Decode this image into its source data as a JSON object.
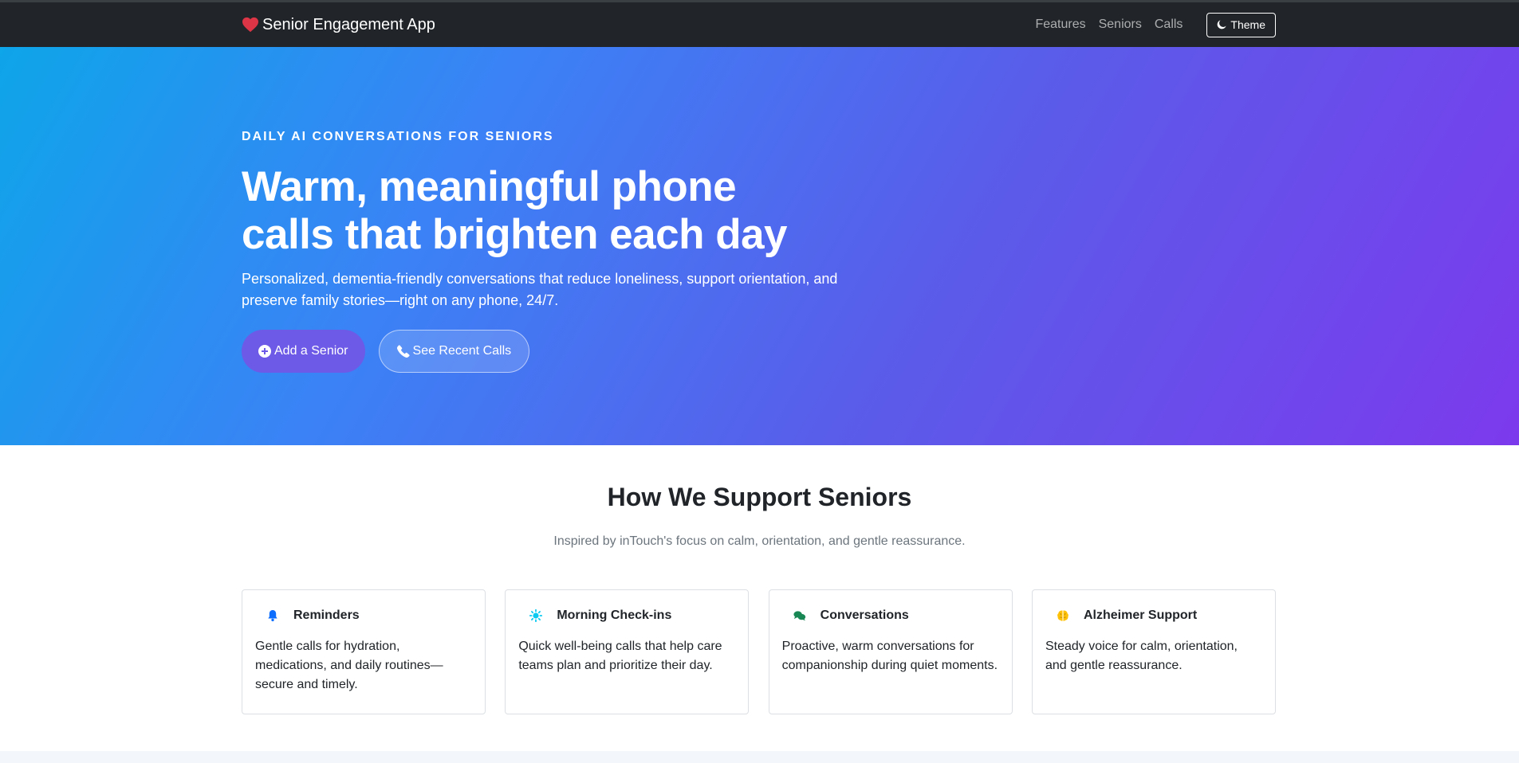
{
  "nav": {
    "brand": "Senior Engagement App",
    "links": [
      "Features",
      "Seniors",
      "Calls"
    ],
    "theme_label": "Theme"
  },
  "hero": {
    "eyebrow": "DAILY AI CONVERSATIONS FOR SENIORS",
    "headline_line1": "Warm, meaningful phone",
    "headline_line2": "calls that brighten each day",
    "subtext": "Personalized, dementia-friendly conversations that reduce loneliness, support orientation, and preserve family stories—right on any phone, 24/7.",
    "primary_button": "Add a Senior",
    "secondary_button": "See Recent Calls"
  },
  "features": {
    "title": "How We Support Seniors",
    "subtitle": "Inspired by inTouch's focus on calm, orientation, and gentle reassurance.",
    "cards": [
      {
        "title": "Reminders",
        "text": "Gentle calls for hydration, medications, and daily routines—secure and timely.",
        "icon": "bell-icon",
        "color": "#0d6efd"
      },
      {
        "title": "Morning Check-ins",
        "text": "Quick well-being calls that help care teams plan and prioritize their day.",
        "icon": "sun-icon",
        "color": "#0dcaf0"
      },
      {
        "title": "Conversations",
        "text": "Proactive, warm conversations for companionship during quiet moments.",
        "icon": "chat-icon",
        "color": "#198754"
      },
      {
        "title": "Alzheimer Support",
        "text": "Steady voice for calm, orientation, and gentle reassurance.",
        "icon": "brain-icon",
        "color": "#ffc107"
      }
    ]
  },
  "colors": {
    "navbar": "#212529",
    "heart": "#dc3545",
    "hero_start": "#0ea5e9",
    "hero_end": "#7c3aed",
    "primary_button": "#6d5ae6"
  }
}
